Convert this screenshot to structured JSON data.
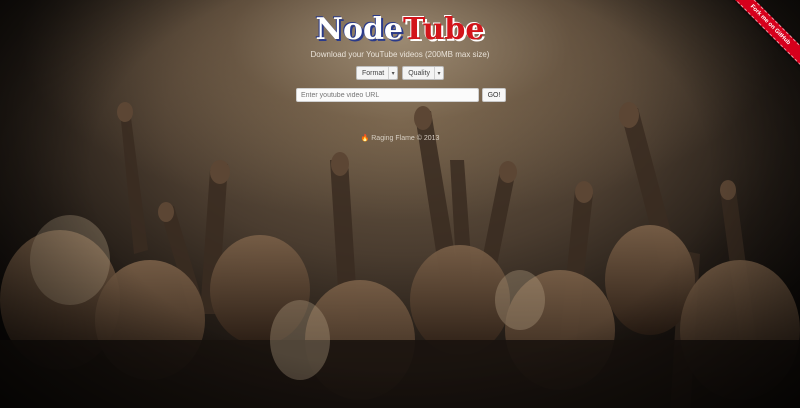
{
  "logo": {
    "part1": "Node",
    "part2": "Tube"
  },
  "subtitle": "Download your YouTube videos (200MB max size)",
  "selects": {
    "format_label": "Format",
    "quality_label": "Quality"
  },
  "search": {
    "placeholder": "Enter youtube video URL",
    "go_label": "GO!"
  },
  "footer": {
    "text": "Raging Flame © 2013"
  },
  "ribbon": {
    "label": "Fork me on GitHub"
  },
  "colors": {
    "tube_red": "#d2151b",
    "node_outline": "#2a3a8a",
    "ribbon_red": "#d6001c"
  },
  "icons": {
    "footer": "flame-icon",
    "select_arrow": "chevron-down-icon"
  }
}
